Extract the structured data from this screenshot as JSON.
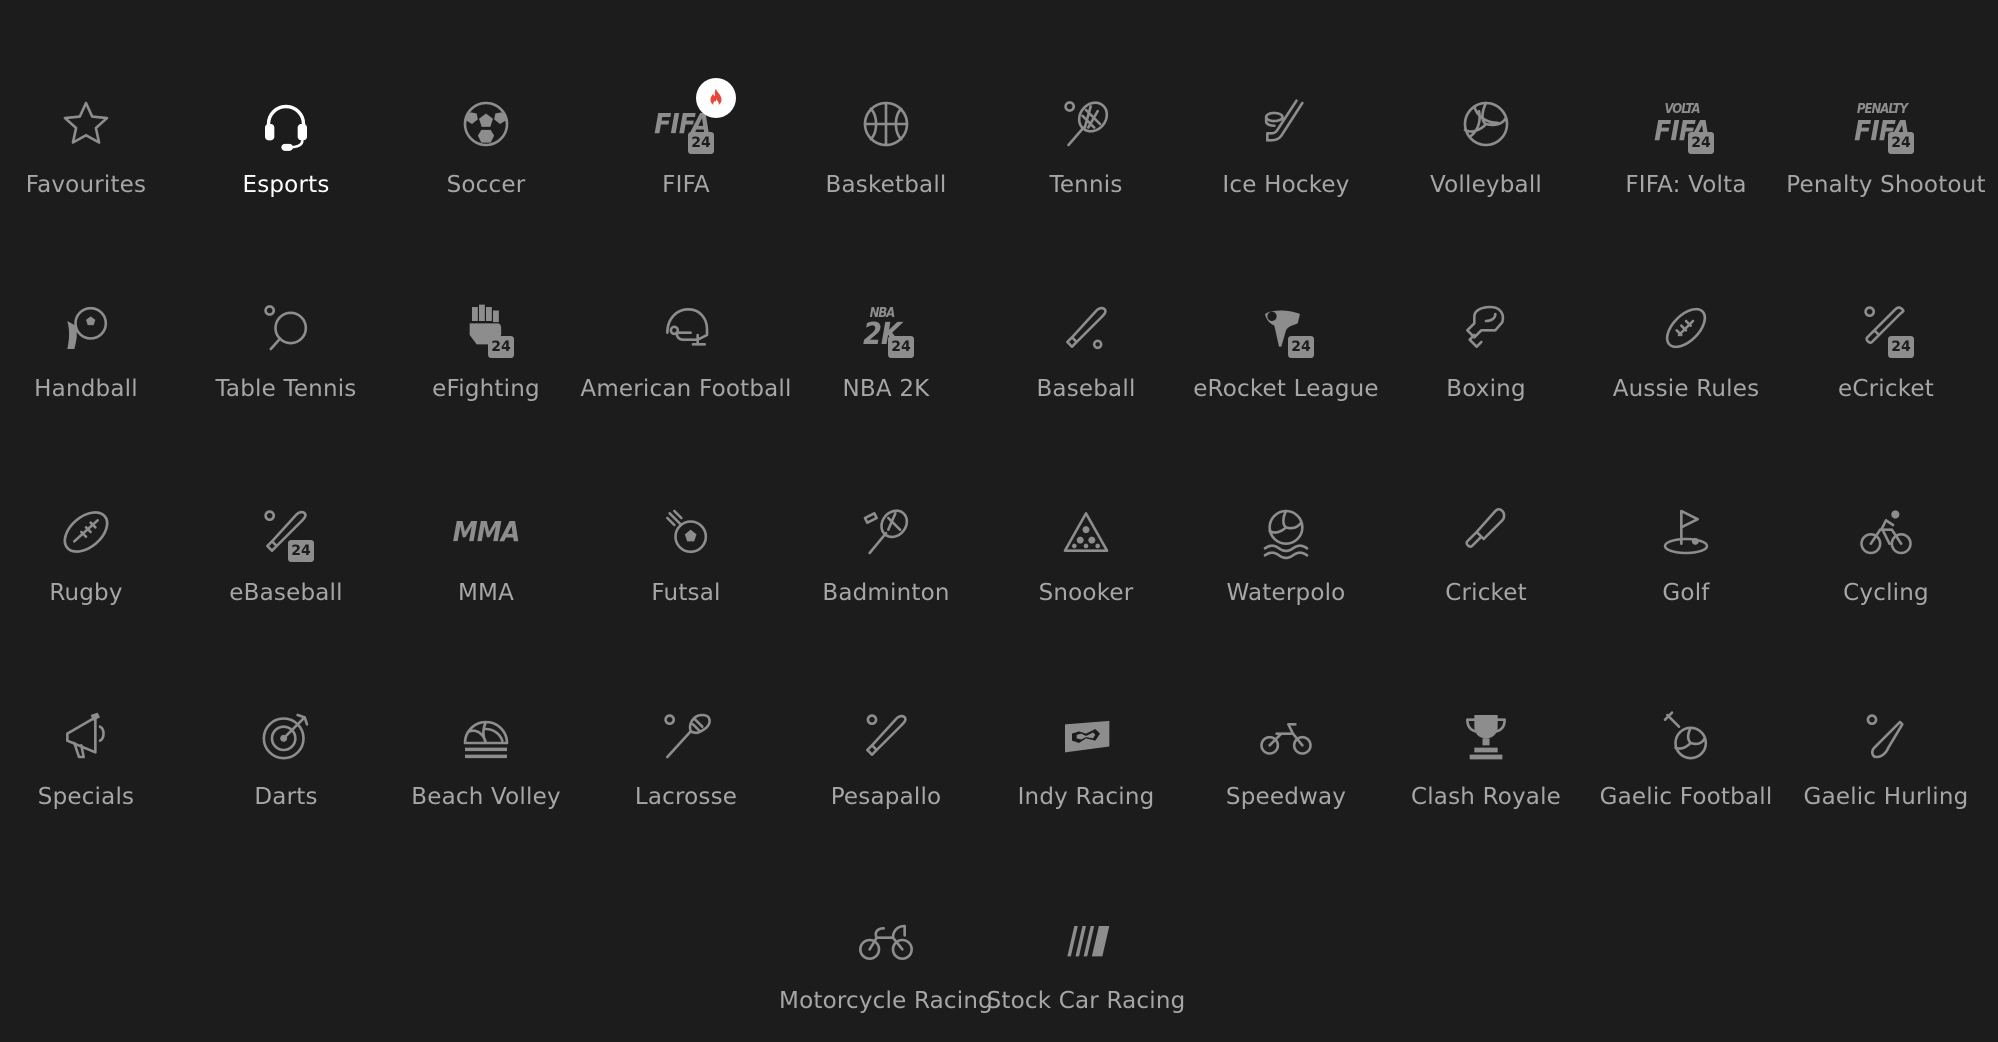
{
  "sports": [
    {
      "label": "Favourites",
      "icon": "star-icon"
    },
    {
      "label": "Esports",
      "icon": "headset-icon",
      "active": true
    },
    {
      "label": "Soccer",
      "icon": "soccer-ball-icon"
    },
    {
      "label": "FIFA",
      "icon": "fifa-24-icon",
      "hot": true,
      "logo_text": "FIFA",
      "badge": "24"
    },
    {
      "label": "Basketball",
      "icon": "basketball-icon"
    },
    {
      "label": "Tennis",
      "icon": "tennis-racket-icon"
    },
    {
      "label": "Ice Hockey",
      "icon": "hockey-stick-icon"
    },
    {
      "label": "Volleyball",
      "icon": "volleyball-icon"
    },
    {
      "label": "FIFA: Volta",
      "icon": "fifa-volta-24-icon",
      "logo_top": "VOLTA",
      "logo_text": "FIFA",
      "badge": "24"
    },
    {
      "label": "Penalty Shootout",
      "icon": "fifa-penalty-24-icon",
      "logo_top": "PENALTY",
      "logo_text": "FIFA",
      "badge": "24"
    },
    {
      "label": "Handball",
      "icon": "handball-icon"
    },
    {
      "label": "Table Tennis",
      "icon": "table-tennis-paddle-icon"
    },
    {
      "label": "eFighting",
      "icon": "fist-24-icon",
      "badge": "24"
    },
    {
      "label": "American Football",
      "icon": "football-helmet-icon"
    },
    {
      "label": "NBA 2K",
      "icon": "nba-2k-24-icon",
      "logo_top": "NBA",
      "logo_text": "2K",
      "badge": "24"
    },
    {
      "label": "Baseball",
      "icon": "baseball-bat-icon"
    },
    {
      "label": "eRocket League",
      "icon": "rocket-car-24-icon",
      "badge": "24"
    },
    {
      "label": "Boxing",
      "icon": "boxing-glove-icon"
    },
    {
      "label": "Aussie Rules",
      "icon": "aussie-rules-ball-icon"
    },
    {
      "label": "eCricket",
      "icon": "cricket-bat-24-icon",
      "badge": "24"
    },
    {
      "label": "Rugby",
      "icon": "rugby-ball-icon"
    },
    {
      "label": "eBaseball",
      "icon": "baseball-bat-24-icon",
      "badge": "24"
    },
    {
      "label": "MMA",
      "icon": "mma-icon",
      "logo_text": "MMA"
    },
    {
      "label": "Futsal",
      "icon": "futsal-icon"
    },
    {
      "label": "Badminton",
      "icon": "badminton-icon"
    },
    {
      "label": "Snooker",
      "icon": "snooker-rack-icon"
    },
    {
      "label": "Waterpolo",
      "icon": "waterpolo-icon"
    },
    {
      "label": "Cricket",
      "icon": "cricket-bat-icon"
    },
    {
      "label": "Golf",
      "icon": "golf-flag-icon"
    },
    {
      "label": "Cycling",
      "icon": "cycling-icon"
    },
    {
      "label": "Specials",
      "icon": "megaphone-icon"
    },
    {
      "label": "Darts",
      "icon": "dartboard-icon"
    },
    {
      "label": "Beach Volley",
      "icon": "beach-volley-icon"
    },
    {
      "label": "Lacrosse",
      "icon": "lacrosse-stick-icon"
    },
    {
      "label": "Pesapallo",
      "icon": "pesapallo-bat-icon"
    },
    {
      "label": "Indy Racing",
      "icon": "race-track-icon"
    },
    {
      "label": "Speedway",
      "icon": "speedway-bike-icon"
    },
    {
      "label": "Clash Royale",
      "icon": "trophy-icon"
    },
    {
      "label": "Gaelic Football",
      "icon": "gaelic-football-icon"
    },
    {
      "label": "Gaelic Hurling",
      "icon": "hurling-stick-icon"
    },
    {
      "label": "Motorcycle Racing",
      "icon": "motorcycle-icon"
    },
    {
      "label": "Stock Car Racing",
      "icon": "stock-car-stripes-icon"
    }
  ],
  "colors": {
    "background": "#1c1c1d",
    "label": "#a6a6a6",
    "label_active": "#ffffff",
    "icon": "#8d8d8d",
    "hot_badge": "#e8463a"
  }
}
